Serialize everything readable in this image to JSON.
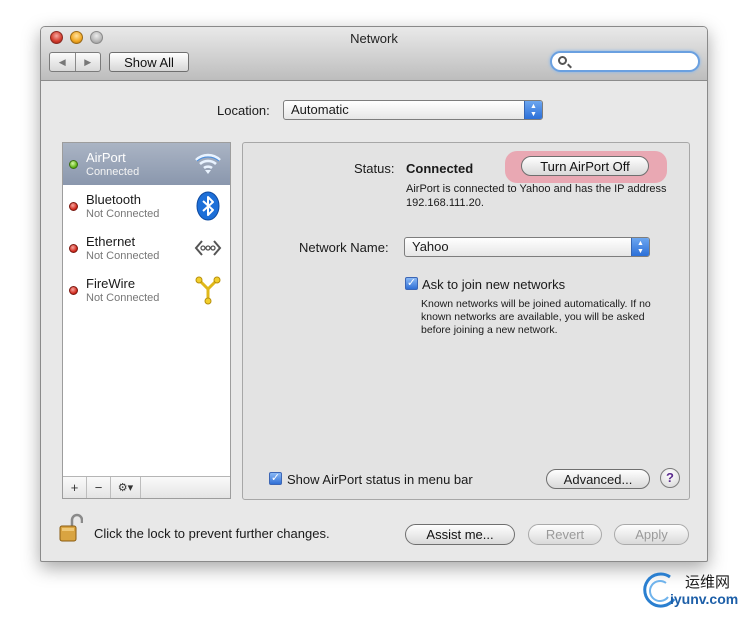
{
  "window": {
    "title": "Network"
  },
  "toolbar": {
    "back": "◀",
    "forward": "▶",
    "show_all": "Show All",
    "search_placeholder": ""
  },
  "location": {
    "label": "Location:",
    "value": "Automatic"
  },
  "services": [
    {
      "name": "AirPort",
      "status": "Connected",
      "state": "green",
      "icon": "wifi-icon"
    },
    {
      "name": "Bluetooth",
      "status": "Not Connected",
      "state": "red",
      "icon": "bluetooth-icon"
    },
    {
      "name": "Ethernet",
      "status": "Not Connected",
      "state": "red",
      "icon": "ethernet-icon"
    },
    {
      "name": "FireWire",
      "status": "Not Connected",
      "state": "red",
      "icon": "firewire-icon"
    }
  ],
  "sidebar_controls": {
    "add": "+",
    "remove": "−",
    "gear": "⚙▾"
  },
  "detail": {
    "status_label": "Status:",
    "status_value": "Connected",
    "turn_off_button": "Turn AirPort Off",
    "status_desc": "AirPort is connected to Yahoo and has the IP address 192.168.111.20.",
    "network_name_label": "Network Name:",
    "network_name_value": "Yahoo",
    "ask_label": "Ask to join new networks",
    "ask_desc": "Known networks will be joined automatically. If no known networks are available, you will be asked before joining a new network.",
    "menubar_label": "Show AirPort status in menu bar",
    "advanced_button": "Advanced...",
    "help_button": "?"
  },
  "footer": {
    "lock_text": "Click the lock to prevent further changes.",
    "assist_button": "Assist me...",
    "revert_button": "Revert",
    "apply_button": "Apply"
  },
  "watermark": {
    "cn": "运维网",
    "url": "iyunv.com"
  },
  "colors": {
    "selected_row": "#8a97ad",
    "accent_blue": "#2c6fd8",
    "highlight_halo": "#ee788c"
  }
}
